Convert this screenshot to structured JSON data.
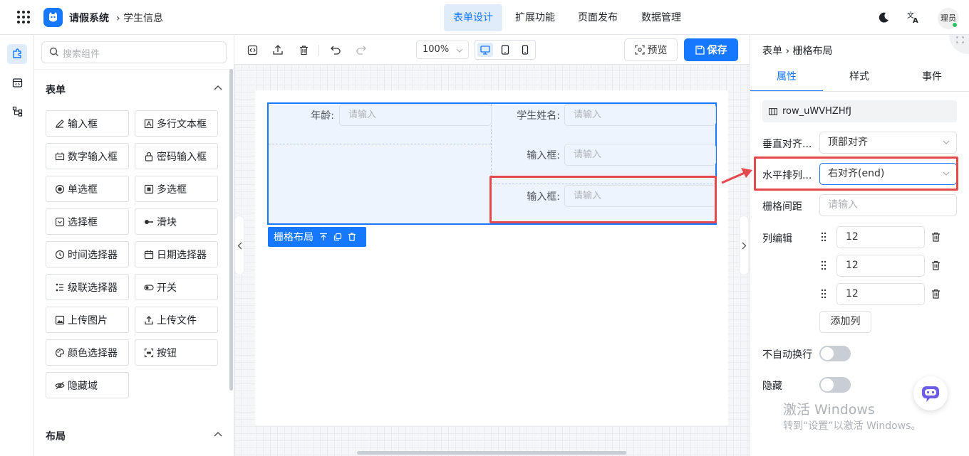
{
  "header": {
    "app_title": "请假系统",
    "breadcrumb": "学生信息",
    "nav_tabs": [
      "表单设计",
      "扩展功能",
      "页面发布",
      "数据管理"
    ],
    "active_tab": "表单设计",
    "avatar_text": "理员",
    "icons": [
      "apps-grid-icon",
      "app-logo-icon",
      "moon-icon",
      "translate-icon"
    ]
  },
  "rail": {
    "items": [
      "components-icon",
      "template-icon",
      "outline-icon"
    ]
  },
  "left_panel": {
    "search_placeholder": "搜索组件",
    "form_section": {
      "title": "表单",
      "items": [
        {
          "label": "输入框",
          "icon": "pencil-icon"
        },
        {
          "label": "多行文本框",
          "icon": "textarea-icon"
        },
        {
          "label": "数字输入框",
          "icon": "number-icon"
        },
        {
          "label": "密码输入框",
          "icon": "lock-icon"
        },
        {
          "label": "单选框",
          "icon": "radio-icon"
        },
        {
          "label": "多选框",
          "icon": "checkbox-icon"
        },
        {
          "label": "选择框",
          "icon": "select-icon"
        },
        {
          "label": "滑块",
          "icon": "slider-icon"
        },
        {
          "label": "时间选择器",
          "icon": "clock-icon"
        },
        {
          "label": "日期选择器",
          "icon": "calendar-icon"
        },
        {
          "label": "级联选择器",
          "icon": "cascader-icon"
        },
        {
          "label": "开关",
          "icon": "switch-icon"
        },
        {
          "label": "上传图片",
          "icon": "image-icon"
        },
        {
          "label": "上传文件",
          "icon": "upload-icon"
        },
        {
          "label": "颜色选择器",
          "icon": "palette-icon"
        },
        {
          "label": "按钮",
          "icon": "button-icon"
        },
        {
          "label": "隐藏域",
          "icon": "eye-off-icon"
        }
      ]
    },
    "layout_section": {
      "title": "布局"
    }
  },
  "toolbar": {
    "zoom": "100%",
    "preview_label": "预览",
    "save_label": "保存"
  },
  "canvas": {
    "fields": {
      "age_label": "年龄:",
      "name_label": "学生姓名:",
      "input1_label": "输入框:",
      "input2_label": "输入框:",
      "placeholder": "请输入"
    },
    "row_tag_label": "栅格布局"
  },
  "right_panel": {
    "breadcrumb": [
      "表单",
      "栅格布局"
    ],
    "tabs": [
      "属性",
      "样式",
      "事件"
    ],
    "active_tab": "属性",
    "row_id": "row_uWVHZHfJ",
    "vertical_align": {
      "label": "垂直对齐...",
      "value": "顶部对齐"
    },
    "horizontal_align": {
      "label": "水平排列...",
      "value": "右对齐(end)"
    },
    "gutter": {
      "label": "栅格间距",
      "placeholder": "请输入"
    },
    "columns": {
      "label": "列编辑",
      "values": [
        "12",
        "12",
        "12"
      ],
      "add_label": "添加列"
    },
    "no_wrap": {
      "label": "不自动换行",
      "on": false
    },
    "hidden": {
      "label": "隐藏",
      "on": false
    }
  },
  "watermark": {
    "line1": "激活 Windows",
    "line2": "转到“设置”以激活 Windows。"
  },
  "colors": {
    "accent": "#1677ff",
    "highlight": "#e5484d"
  }
}
